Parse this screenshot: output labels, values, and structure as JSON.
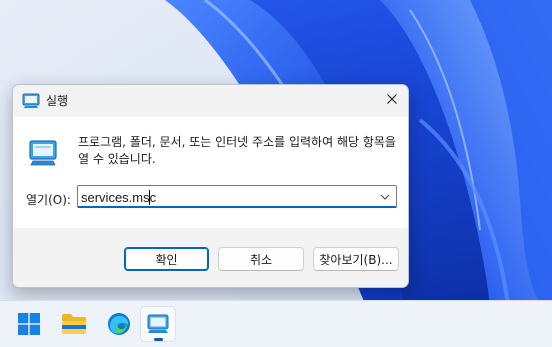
{
  "dialog": {
    "title": "실행",
    "description": "프로그램, 폴더, 문서, 또는 인터넷 주소를 입력하여 해당 항목을 열 수 있습니다.",
    "open_label": "열기(O):",
    "input_value": "services.msc",
    "buttons": {
      "ok": "확인",
      "cancel": "취소",
      "browse": "찾아보기(B)..."
    },
    "icons": {
      "title": "run-icon",
      "content": "run-icon",
      "close": "close-icon",
      "dropdown": "chevron-down-icon"
    }
  },
  "taskbar": {
    "items": [
      {
        "icon": "windows-start-icon"
      },
      {
        "icon": "file-explorer-icon"
      },
      {
        "icon": "edge-browser-icon"
      },
      {
        "icon": "run-icon",
        "active": true
      }
    ]
  },
  "colors": {
    "accent": "#0067c0",
    "wallpaper_blue": "#1a4fe0"
  }
}
